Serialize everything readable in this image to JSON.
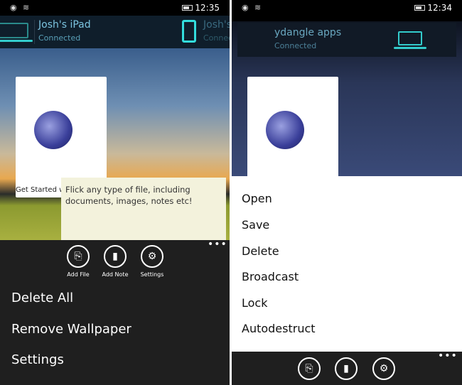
{
  "left": {
    "status": {
      "time": "12:35"
    },
    "devices": [
      {
        "name": "Josh's iPad",
        "status": "Connected"
      },
      {
        "name": "Josh's",
        "status": "Connected"
      }
    ],
    "tile_caption": "Get Started w",
    "note_text": "Flick any type of file, including documents, images, notes etc!",
    "appbar": [
      {
        "label": "Add File",
        "icon": "add-file-icon"
      },
      {
        "label": "Add Note",
        "icon": "note-icon"
      },
      {
        "label": "Settings",
        "icon": "gear-icon"
      }
    ],
    "more": "•••",
    "menu": [
      "Delete All",
      "Remove Wallpaper",
      "Settings"
    ]
  },
  "right": {
    "status": {
      "time": "12:34"
    },
    "device": {
      "name": "ydangle apps",
      "status": "Connected"
    },
    "context_menu": [
      "Open",
      "Save",
      "Delete",
      "Broadcast",
      "Lock",
      "Autodestruct"
    ],
    "more": "•••",
    "appbar": [
      {
        "icon": "add-file-icon"
      },
      {
        "icon": "note-icon"
      },
      {
        "icon": "gear-icon"
      }
    ]
  }
}
